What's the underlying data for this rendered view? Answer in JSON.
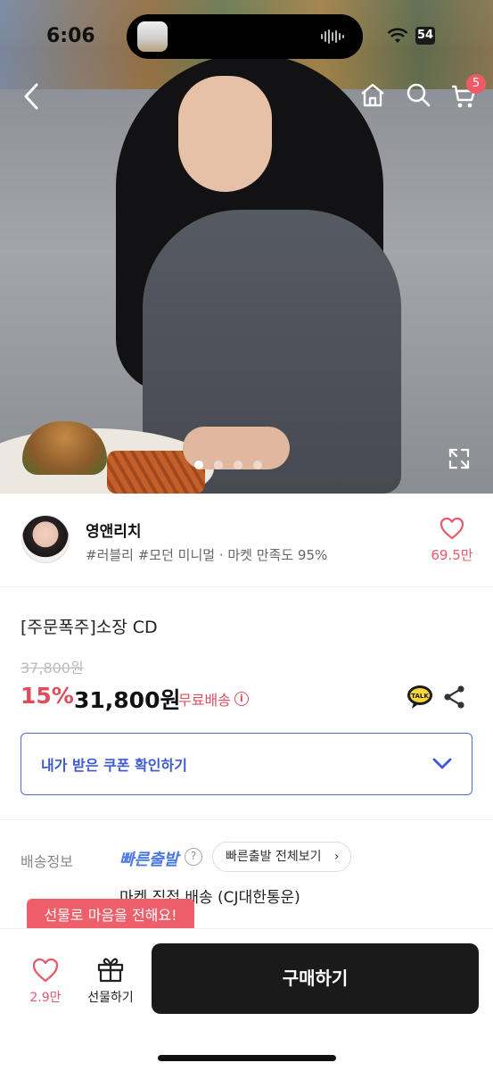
{
  "status_bar": {
    "time": "6:06",
    "battery": "54"
  },
  "nav": {
    "cart_badge": "5",
    "icons": [
      "back-icon",
      "home-icon",
      "search-icon",
      "cart-icon"
    ]
  },
  "gallery": {
    "slide_count": 4,
    "active_index": 0
  },
  "seller": {
    "name": "영앤리치",
    "tags": "#러블리 #모던 미니멀 · 마켓 만족도 95%",
    "like_count": "69.5만"
  },
  "product": {
    "title": "[주문폭주]소장 CD",
    "original_price": "37,800원",
    "discount": "15%",
    "price": "31,800원",
    "shipping_badge": "무료배송",
    "coupon_label": "내가 받은 쿠폰 확인하기"
  },
  "shipping": {
    "label": "배송정보",
    "fast_label": "빠른출발",
    "help": "?",
    "fast_all_button": "빠른출발 전체보기",
    "method": "마켓 직접 배송 (CJ대한통운)"
  },
  "tooltip": "선물로 마음을 전해요!",
  "bottom_bar": {
    "wish_count": "2.9만",
    "gift_label": "선물하기",
    "buy_label": "구매하기"
  },
  "colors": {
    "accent_red": "#e04e5e",
    "accent_blue": "#3d5bd1",
    "buy_button": "#1a1a1a"
  }
}
